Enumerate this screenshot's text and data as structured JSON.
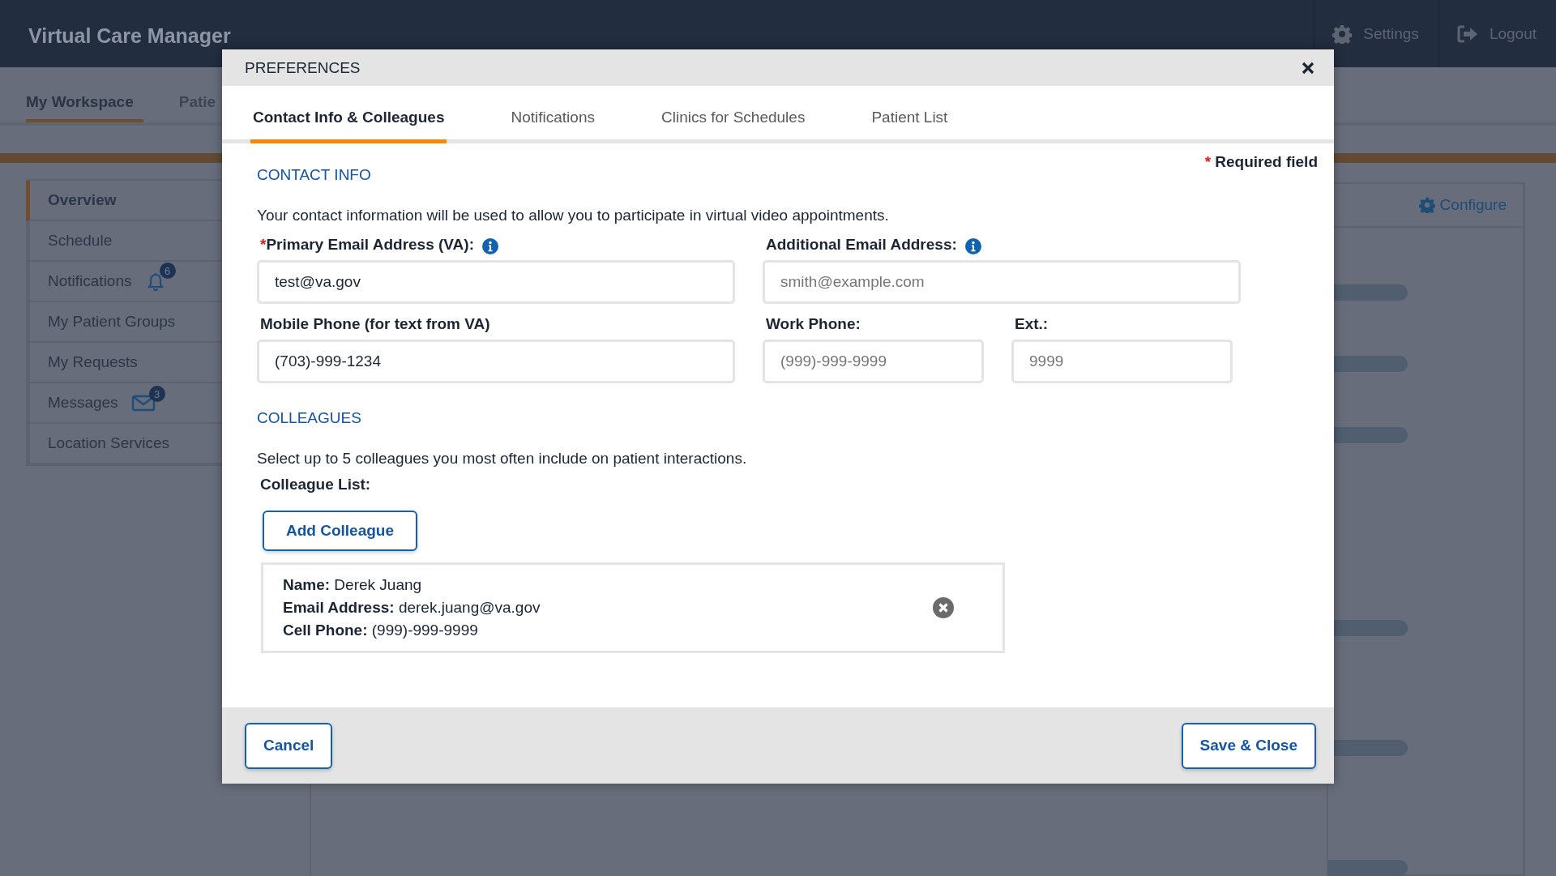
{
  "header": {
    "title": "Virtual Care Manager",
    "actions": [
      {
        "kind": "settings",
        "label": "Settings"
      },
      {
        "kind": "logout",
        "label": "Logout"
      }
    ]
  },
  "nav_tabs": [
    {
      "label": "My Workspace",
      "selected": true
    },
    {
      "label": "Patie",
      "selected": false
    }
  ],
  "sidebar": {
    "items": [
      {
        "label": "Overview",
        "selected": true
      },
      {
        "label": "Schedule",
        "selected": false
      },
      {
        "label": "Notifications",
        "selected": false,
        "kind": "bell",
        "badge": "6"
      },
      {
        "label": "My Patient Groups",
        "selected": false
      },
      {
        "label": "My Requests",
        "selected": false
      },
      {
        "label": "Messages",
        "selected": false,
        "kind": "envelope",
        "badge": "3"
      },
      {
        "label": "Location Services",
        "selected": false
      }
    ]
  },
  "panel": {
    "action": "Configure"
  },
  "dialog": {
    "title": "PREFERENCES",
    "required_mark": "*",
    "tabs": [
      {
        "label": "Contact Info & Colleagues",
        "selected": true
      },
      {
        "label": "Notifications",
        "selected": false
      },
      {
        "label": "Clinics for Schedules",
        "selected": false
      },
      {
        "label": "Patient List",
        "selected": false
      }
    ],
    "required_note": "Required field",
    "contact": {
      "heading": "CONTACT INFO",
      "intro": "Your contact information will be used to allow you to participate in virtual video appointments.",
      "rows": [
        [
          {
            "label": "Primary Email Address (VA):",
            "required": true,
            "info": true,
            "value": "test@va.gov"
          },
          {
            "label": "Additional Email Address:",
            "required": false,
            "info": true,
            "placeholder": "smith@example.com"
          }
        ],
        [
          {
            "label": "Mobile Phone (for text from VA)",
            "required": false,
            "info": false,
            "value": "(703)-999-1234"
          },
          {
            "label": "Work Phone:",
            "required": false,
            "info": false,
            "placeholder": "(999)-999-9999"
          },
          {
            "label": "Ext.:",
            "required": false,
            "info": false,
            "placeholder": "9999"
          }
        ]
      ]
    },
    "colleagues": {
      "heading": "COLLEAGUES",
      "intro": "Select up to 5 colleagues you most often include on patient interactions.",
      "list_label": "Colleague List:",
      "add_button": "Add Colleague",
      "items": [
        {
          "lines": [
            "**Name:** Derek Juang",
            "**Email Address:** derek.juang@va.gov",
            "**Cell Phone:** (999)-999-9999"
          ]
        }
      ]
    },
    "buttons": {
      "cancel": "Cancel",
      "save": "Save & Close"
    }
  }
}
